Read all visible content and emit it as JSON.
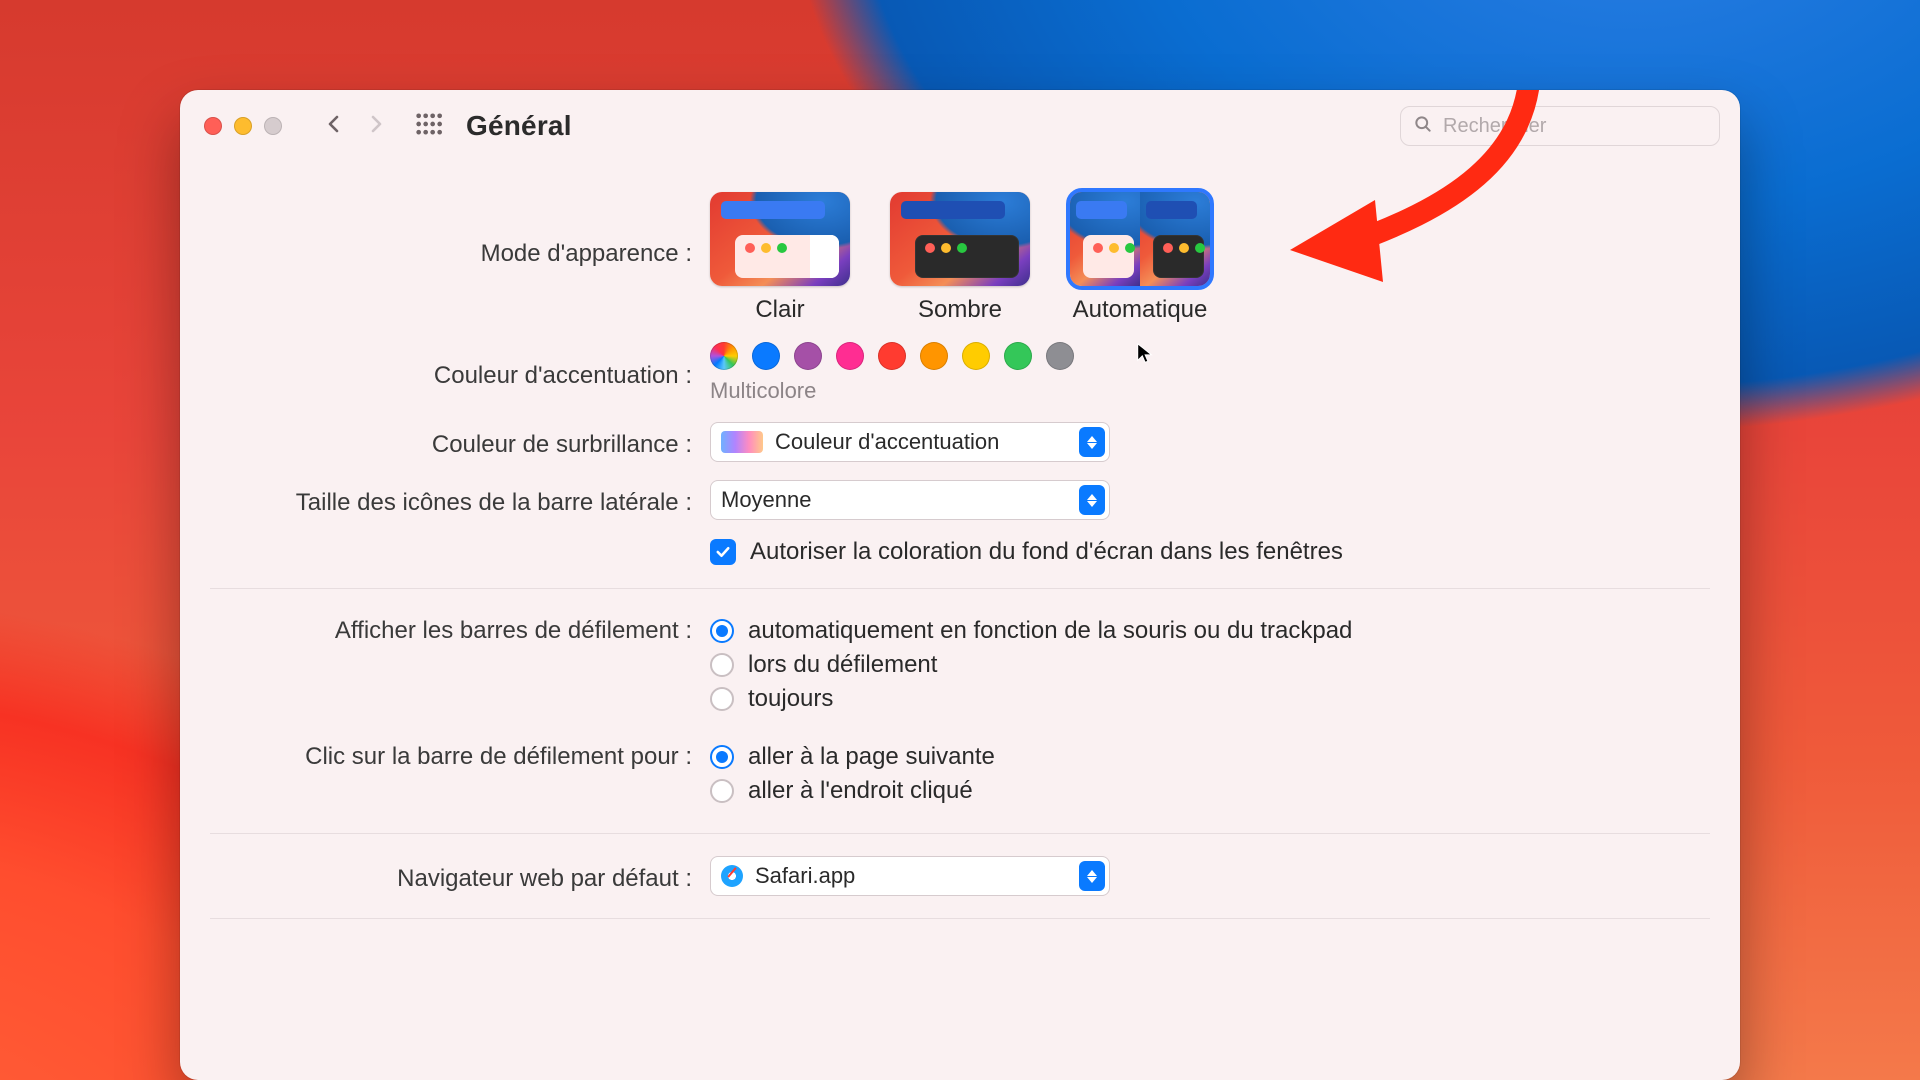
{
  "toolbar": {
    "title": "Général",
    "search_placeholder": "Rechercher"
  },
  "labels": {
    "appearance": "Mode d'apparence :",
    "accent": "Couleur d'accentuation :",
    "highlight": "Couleur de surbrillance :",
    "sidebar_icon": "Taille des icônes de la barre latérale :",
    "tint_check": "Autoriser la coloration du fond d'écran dans les fenêtres",
    "scrollbars": "Afficher les barres de défilement :",
    "scrollclick": "Clic sur la barre de défilement pour :",
    "browser": "Navigateur web par défaut :"
  },
  "appearance": {
    "options": [
      {
        "label": "Clair"
      },
      {
        "label": "Sombre"
      },
      {
        "label": "Automatique"
      }
    ],
    "selected_index": 2
  },
  "accent": {
    "colors": [
      "multicolor",
      "#0a7aff",
      "#a550a7",
      "#ff2d92",
      "#ff3b30",
      "#ff9500",
      "#ffcc00",
      "#34c759",
      "#8e8e93"
    ],
    "label_below": "Multicolore"
  },
  "highlight_select": {
    "value": "Couleur d'accentuation"
  },
  "sidebar_select": {
    "value": "Moyenne"
  },
  "browser_select": {
    "value": "Safari.app"
  },
  "scrollbars": {
    "options": [
      "automatiquement en fonction de la souris ou du trackpad",
      "lors du défilement",
      "toujours"
    ],
    "selected_index": 0
  },
  "scrollclick": {
    "options": [
      "aller à la page suivante",
      "aller à l'endroit cliqué"
    ],
    "selected_index": 0
  }
}
